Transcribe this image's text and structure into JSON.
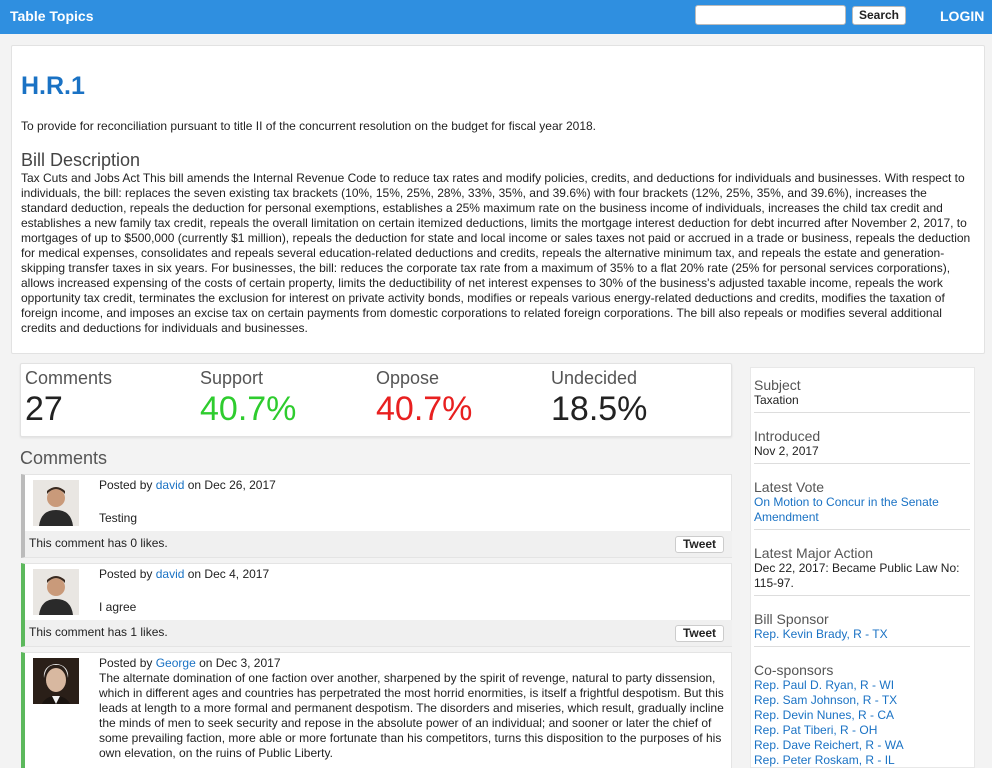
{
  "nav": {
    "brand": "Table Topics",
    "search_placeholder": "",
    "search_button": "Search",
    "login": "LOGIN"
  },
  "bill": {
    "number": "H.R.1",
    "official_title": "To provide for reconciliation pursuant to title II of the concurrent resolution on the budget for fiscal year 2018.",
    "description_heading": "Bill Description",
    "description": "Tax Cuts and Jobs Act This bill amends the Internal Revenue Code to reduce tax rates and modify policies, credits, and deductions for individuals and businesses. With respect to individuals, the bill: replaces the seven existing tax brackets (10%, 15%, 25%, 28%, 33%, 35%, and 39.6%) with four brackets (12%, 25%, 35%, and 39.6%), increases the standard deduction, repeals the deduction for personal exemptions, establishes a 25% maximum rate on the business income of individuals, increases the child tax credit and establishes a new family tax credit, repeals the overall limitation on certain itemized deductions, limits the mortgage interest deduction for debt incurred after November 2, 2017, to mortgages of up to $500,000 (currently $1 million), repeals the deduction for state and local income or sales taxes not paid or accrued in a trade or business, repeals the deduction for medical expenses, consolidates and repeals several education-related deductions and credits, repeals the alternative minimum tax, and repeals the estate and generation-skipping transfer taxes in six years. For businesses, the bill: reduces the corporate tax rate from a maximum of 35% to a flat 20% rate (25% for personal services corporations), allows increased expensing of the costs of certain property, limits the deductibility of net interest expenses to 30% of the business's adjusted taxable income, repeals the work opportunity tax credit, terminates the exclusion for interest on private activity bonds, modifies or repeals various energy-related deductions and credits, modifies the taxation of foreign income, and imposes an excise tax on certain payments from domestic corporations to related foreign corporations. The bill also repeals or modifies several additional credits and deductions for individuals and businesses."
  },
  "stats": {
    "comments_label": "Comments",
    "comments_value": "27",
    "support_label": "Support",
    "support_value": "40.7%",
    "oppose_label": "Oppose",
    "oppose_value": "40.7%",
    "undecided_label": "Undecided",
    "undecided_value": "18.5%"
  },
  "colors": {
    "support": "#2ecc2e",
    "oppose": "#e82020",
    "accent": "#1a72c4",
    "navbar": "#2f8fe0"
  },
  "comments_heading": "Comments",
  "comments": [
    {
      "posted_by": "Posted by",
      "author": "david",
      "on_date": "on Dec 26, 2017",
      "body": "Testing",
      "likes": "This comment has 0 likes.",
      "tweet": "Tweet"
    },
    {
      "posted_by": "Posted by",
      "author": "david",
      "on_date": "on Dec 4, 2017",
      "body": "I agree",
      "likes": "This comment has 1 likes.",
      "tweet": "Tweet"
    },
    {
      "posted_by": "Posted by",
      "author": "George",
      "on_date": "on Dec 3, 2017",
      "body": "The alternate domination of one faction over another, sharpened by the spirit of revenge, natural to party dissension, which in different ages and countries has perpetrated the most horrid enormities, is itself a frightful despotism. But this leads at length to a more formal and permanent despotism. The disorders and miseries, which result, gradually incline the minds of men to seek security and repose in the absolute power of an individual; and sooner or later the chief of some prevailing faction, more able or more fortunate than his competitors, turns this disposition to the purposes of his own elevation, on the ruins of Public Liberty."
    }
  ],
  "sidebar": {
    "subject_label": "Subject",
    "subject": "Taxation",
    "introduced_label": "Introduced",
    "introduced": "Nov 2, 2017",
    "latest_vote_label": "Latest Vote",
    "latest_vote": "On Motion to Concur in the Senate Amendment",
    "latest_action_label": "Latest Major Action",
    "latest_action": "Dec 22, 2017: Became Public Law No: 115-97.",
    "sponsor_label": "Bill Sponsor",
    "sponsor": "Rep. Kevin Brady, R - TX",
    "cosponsors_label": "Co-sponsors",
    "cosponsors": [
      "Rep. Paul D. Ryan, R - WI",
      "Rep. Sam Johnson, R - TX",
      "Rep. Devin Nunes, R - CA",
      "Rep. Pat Tiberi, R - OH",
      "Rep. Dave Reichert, R - WA",
      "Rep. Peter Roskam, R - IL"
    ]
  }
}
